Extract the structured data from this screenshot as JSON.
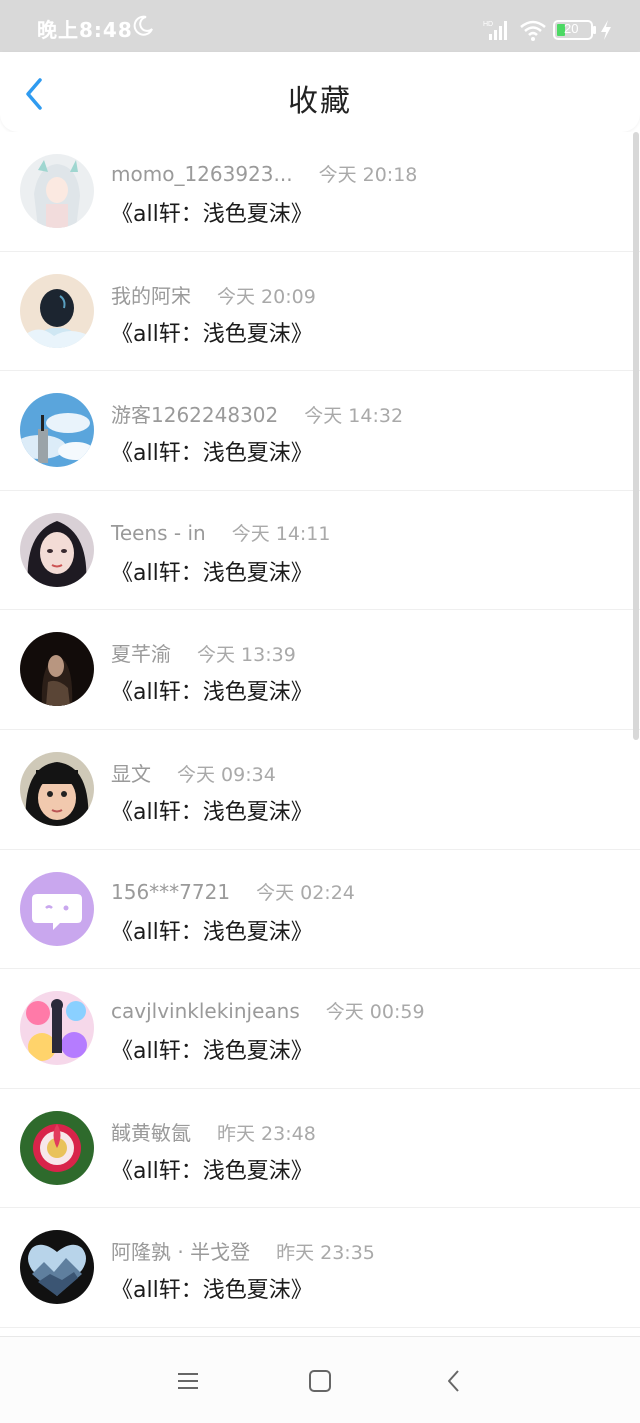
{
  "status_bar": {
    "time": "晚上8:48",
    "battery": "20"
  },
  "header": {
    "title": "收藏"
  },
  "items": [
    {
      "user": "momo_1263923...",
      "time": "今天 20:18",
      "title": "《all轩：浅色夏沫》",
      "avatar": "avatar-anime-girl-icon"
    },
    {
      "user": "我的阿宋",
      "time": "今天 20:09",
      "title": "《all轩：浅色夏沫》",
      "avatar": "avatar-back-of-head-icon"
    },
    {
      "user": "游客1262248302",
      "time": "今天 14:32",
      "title": "《all轩：浅色夏沫》",
      "avatar": "avatar-sky-icon"
    },
    {
      "user": "Teens - in",
      "time": "今天 14:11",
      "title": "《all轩：浅色夏沫》",
      "avatar": "avatar-portrait-icon"
    },
    {
      "user": "夏芊渝",
      "time": "今天 13:39",
      "title": "《all轩：浅色夏沫》",
      "avatar": "avatar-dark-portrait-icon"
    },
    {
      "user": "显文",
      "time": "今天 09:34",
      "title": "《all轩：浅色夏沫》",
      "avatar": "avatar-child-icon"
    },
    {
      "user": "156***7721",
      "time": "今天 02:24",
      "title": "《all轩：浅色夏沫》",
      "avatar": "avatar-default-chat-icon"
    },
    {
      "user": "cavjlvinklekinjeans",
      "time": "今天 00:59",
      "title": "《all轩：浅色夏沫》",
      "avatar": "avatar-colorful-art-icon"
    },
    {
      "user": "馘黄敏氤",
      "time": "昨天 23:48",
      "title": "《all轩：浅色夏沫》",
      "avatar": "avatar-flower-icon"
    },
    {
      "user": "阿隆孰 · 半戈登",
      "time": "昨天 23:35",
      "title": "《all轩：浅色夏沫》",
      "avatar": "avatar-mountain-heart-icon"
    }
  ],
  "colors": {
    "accent": "#2f9bf0",
    "status_bar": "#d9d9d9",
    "meta_text": "#9a9a9a"
  }
}
